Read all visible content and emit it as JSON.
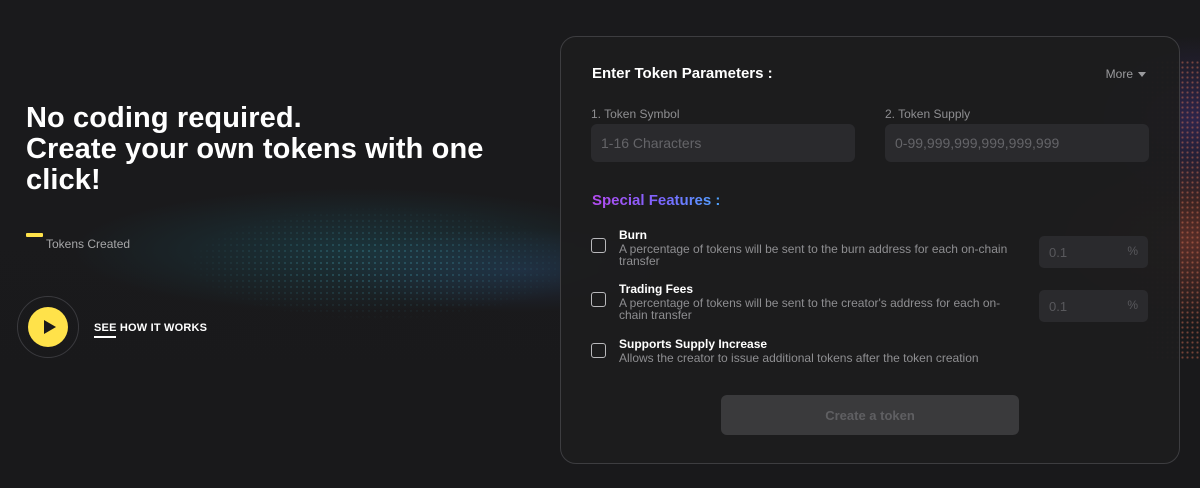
{
  "hero": {
    "title_lines": [
      "No coding required.",
      "Create your own tokens with one",
      "click!"
    ],
    "stat_label": "Tokens Created",
    "video_label": "SEE HOW IT WORKS"
  },
  "form": {
    "title": "Enter Token Parameters :",
    "more_label": "More",
    "symbol": {
      "label": "1. Token Symbol",
      "placeholder": "1-16 Characters",
      "value": ""
    },
    "supply": {
      "label": "2. Token Supply",
      "placeholder": "0-99,999,999,999,999,999",
      "value": ""
    },
    "features_title": "Special Features :",
    "features": [
      {
        "name": "Burn",
        "description": "A percentage of tokens will be sent to the burn address for each on-chain transfer",
        "checked": false,
        "percent_placeholder": "0.1",
        "percent_sign": "%"
      },
      {
        "name": "Trading Fees",
        "description": "A percentage of tokens will be sent to the creator's address for each on-chain transfer",
        "checked": false,
        "percent_placeholder": "0.1",
        "percent_sign": "%"
      },
      {
        "name": "Supports Supply Increase",
        "description": "Allows the creator to issue additional tokens after the token creation",
        "checked": false
      }
    ],
    "submit_label": "Create a token"
  },
  "colors": {
    "accent_yellow": "#ffe24a",
    "background": "#19191b",
    "panel": "#1c1c1e",
    "input": "#2a2a2d",
    "features_gradient": [
      "#b44bf0",
      "#4fa4ff"
    ],
    "button_disabled": "#3a3a3c"
  },
  "icons": {
    "play": "play-icon",
    "more_caret": "caret-down-icon"
  }
}
